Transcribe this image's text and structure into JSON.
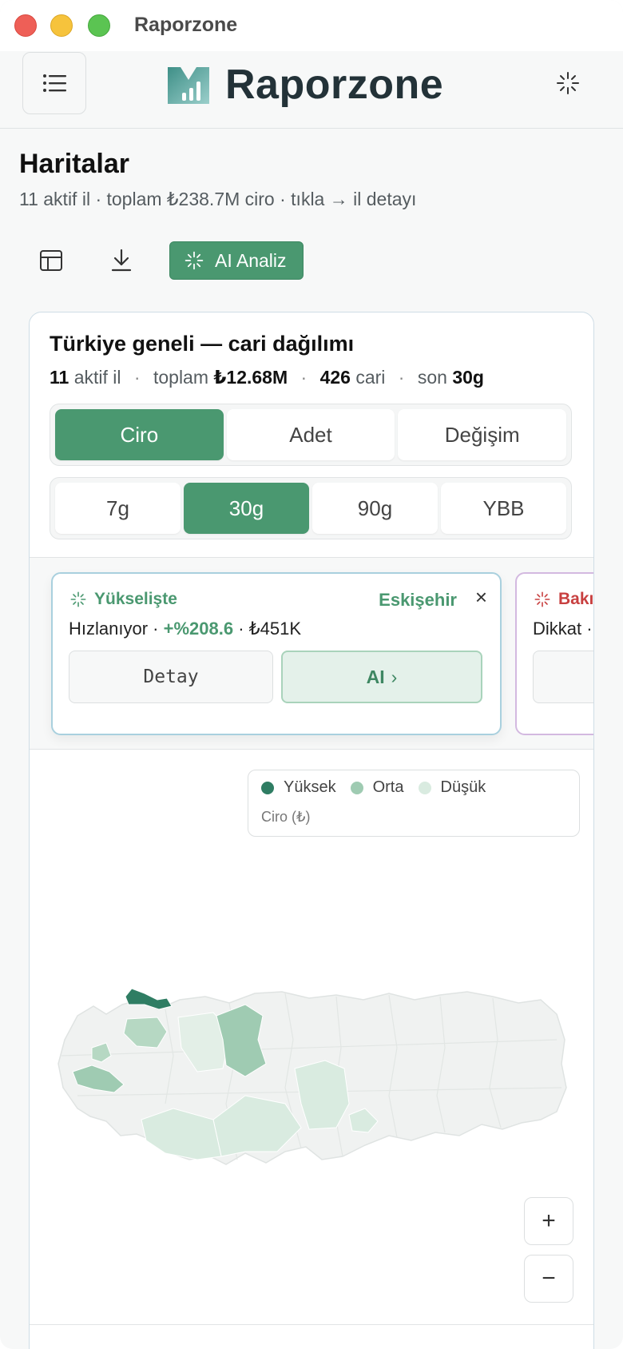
{
  "window": {
    "title": "Raporzone"
  },
  "header": {
    "brand_name": "Raporzone",
    "menu_icon": "hamburger-menu-icon",
    "sparkle_icon": "sparkle-icon"
  },
  "page": {
    "title": "Haritalar",
    "subtitle": "11 aktif il · toplam ₺238.7M ciro · tıkla → il detayı"
  },
  "toolbar": {
    "table_icon": "table-icon",
    "download_icon": "download-icon",
    "ai_label": "AI Analiz"
  },
  "card": {
    "title": "Türkiye geneli — cari dağılımı",
    "stats": {
      "active_count": "11",
      "active_label": "aktif il",
      "total_label": "toplam",
      "total_value": "₺12.68M",
      "cari_count": "426",
      "cari_label": "cari",
      "period_label": "son",
      "period_value": "30g"
    },
    "metric_tabs": [
      {
        "label": "Ciro",
        "active": true
      },
      {
        "label": "Adet",
        "active": false
      },
      {
        "label": "Değişim",
        "active": false
      }
    ],
    "period_tabs": [
      {
        "label": "7g",
        "active": false
      },
      {
        "label": "30g",
        "active": true
      },
      {
        "label": "90g",
        "active": false
      },
      {
        "label": "YBB",
        "active": false
      }
    ]
  },
  "insights": [
    {
      "tag": "Yükselişte",
      "city": "Eskişehir",
      "close": "×",
      "body_prefix": "Hızlanıyor ·",
      "change": "+%208.6",
      "body_suffix": "· ₺451K",
      "detail_label": "Detay",
      "ai_label": "AI",
      "ai_chevron": "›",
      "color": "#4a9870"
    },
    {
      "tag": "Bakı",
      "body_prefix": "Dikkat ·",
      "color": "#c84040"
    }
  ],
  "legend": {
    "items": [
      {
        "label": "Yüksek",
        "color": "#2f7d63"
      },
      {
        "label": "Orta",
        "color": "#9fcbb2"
      },
      {
        "label": "Düşük",
        "color": "#d9ebe0"
      }
    ],
    "caption": "Ciro (₺)"
  },
  "zoom": {
    "in_label": "+",
    "out_label": "−"
  }
}
